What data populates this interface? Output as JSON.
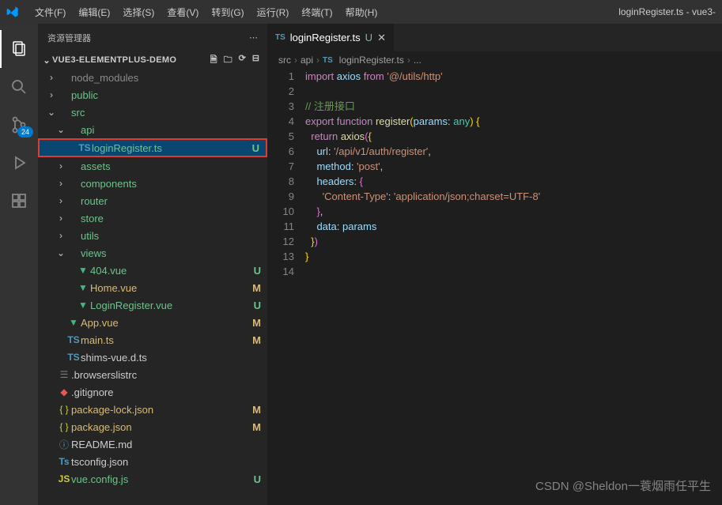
{
  "window": {
    "title": "loginRegister.ts - vue3-"
  },
  "menubar": [
    "文件(F)",
    "编辑(E)",
    "选择(S)",
    "查看(V)",
    "转到(G)",
    "运行(R)",
    "终端(T)",
    "帮助(H)"
  ],
  "activitybar": {
    "scm_badge": "24"
  },
  "sidebar": {
    "title": "资源管理器",
    "section": "VUE3-ELEMENTPLUS-DEMO",
    "tree": [
      {
        "depth": 0,
        "twisty": ">",
        "icon": "folder",
        "name": "node_modules",
        "status": "",
        "color": "#8a8a8a"
      },
      {
        "depth": 0,
        "twisty": ">",
        "icon": "folder",
        "name": "public",
        "status": "",
        "cls": "git-u"
      },
      {
        "depth": 0,
        "twisty": "v",
        "icon": "folder",
        "name": "src",
        "status": "",
        "cls": "git-u"
      },
      {
        "depth": 1,
        "twisty": "v",
        "icon": "folder",
        "name": "api",
        "status": "",
        "cls": "git-u"
      },
      {
        "depth": 2,
        "twisty": "",
        "icon": "ts",
        "name": "loginRegister.ts",
        "status": "U",
        "selected": true,
        "cls": "git-u"
      },
      {
        "depth": 1,
        "twisty": ">",
        "icon": "folder",
        "name": "assets",
        "status": "",
        "cls": "git-u"
      },
      {
        "depth": 1,
        "twisty": ">",
        "icon": "folder",
        "name": "components",
        "status": "",
        "cls": "git-u"
      },
      {
        "depth": 1,
        "twisty": ">",
        "icon": "folder",
        "name": "router",
        "status": "",
        "cls": "git-u"
      },
      {
        "depth": 1,
        "twisty": ">",
        "icon": "folder",
        "name": "store",
        "status": "",
        "cls": "git-u"
      },
      {
        "depth": 1,
        "twisty": ">",
        "icon": "folder",
        "name": "utils",
        "status": "",
        "cls": "git-u"
      },
      {
        "depth": 1,
        "twisty": "v",
        "icon": "folder",
        "name": "views",
        "status": "",
        "cls": "git-u"
      },
      {
        "depth": 2,
        "twisty": "",
        "icon": "vue",
        "name": "404.vue",
        "status": "U",
        "cls": "git-u"
      },
      {
        "depth": 2,
        "twisty": "",
        "icon": "vue",
        "name": "Home.vue",
        "status": "M",
        "cls": "git-m"
      },
      {
        "depth": 2,
        "twisty": "",
        "icon": "vue",
        "name": "LoginRegister.vue",
        "status": "U",
        "cls": "git-u"
      },
      {
        "depth": 1,
        "twisty": "",
        "icon": "vue",
        "name": "App.vue",
        "status": "M",
        "cls": "git-m"
      },
      {
        "depth": 1,
        "twisty": "",
        "icon": "ts",
        "name": "main.ts",
        "status": "M",
        "cls": "git-m"
      },
      {
        "depth": 1,
        "twisty": "",
        "icon": "ts",
        "name": "shims-vue.d.ts",
        "status": ""
      },
      {
        "depth": 0,
        "twisty": "",
        "icon": "conf",
        "name": ".browserslistrc",
        "status": ""
      },
      {
        "depth": 0,
        "twisty": "",
        "icon": "git",
        "name": ".gitignore",
        "status": ""
      },
      {
        "depth": 0,
        "twisty": "",
        "icon": "json",
        "name": "package-lock.json",
        "status": "M",
        "cls": "git-m"
      },
      {
        "depth": 0,
        "twisty": "",
        "icon": "json",
        "name": "package.json",
        "status": "M",
        "cls": "git-m"
      },
      {
        "depth": 0,
        "twisty": "",
        "icon": "info",
        "name": "README.md",
        "status": ""
      },
      {
        "depth": 0,
        "twisty": "",
        "icon": "tsconf",
        "name": "tsconfig.json",
        "status": ""
      },
      {
        "depth": 0,
        "twisty": "",
        "icon": "js",
        "name": "vue.config.js",
        "status": "U",
        "cls": "git-u"
      }
    ]
  },
  "tab": {
    "icon": "TS",
    "name": "loginRegister.ts",
    "status": "U"
  },
  "breadcrumb": [
    "src",
    "api",
    "loginRegister.ts",
    "..."
  ],
  "code_lines": 14,
  "watermark": "CSDN @Sheldon一蓑烟雨任平生"
}
